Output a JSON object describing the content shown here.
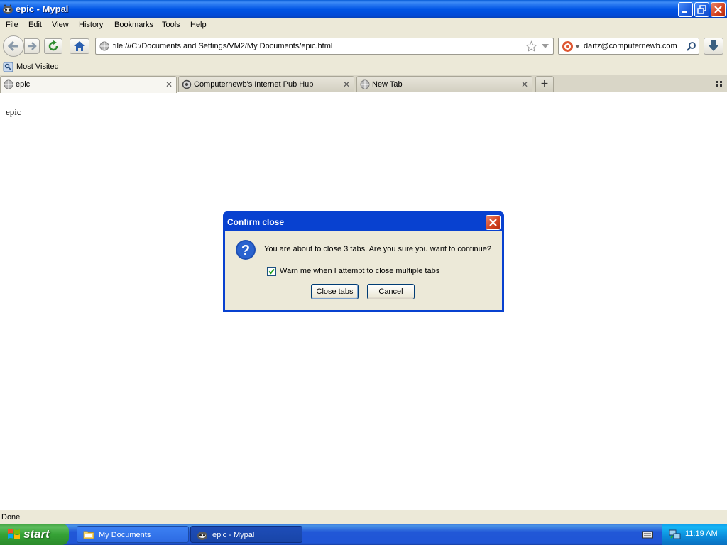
{
  "window": {
    "title": "epic - Mypal",
    "app_icon": "mypal-raccoon-icon"
  },
  "menu": {
    "items": [
      "File",
      "Edit",
      "View",
      "History",
      "Bookmarks",
      "Tools",
      "Help"
    ]
  },
  "navigation": {
    "url": "file:///C:/Documents and Settings/VM2/My Documents/epic.html",
    "search_text": "dartz@computernewb.com",
    "search_engine_icon": "duckduckgo-icon"
  },
  "bookmarks": {
    "most_visited": "Most Visited"
  },
  "tabs": [
    {
      "label": "epic",
      "active": true
    },
    {
      "label": "Computernewb's Internet Pub Hub",
      "active": false
    },
    {
      "label": "New Tab",
      "active": false
    }
  ],
  "content": {
    "text": "epic"
  },
  "dialog": {
    "title": "Confirm close",
    "message": "You are about to close 3 tabs. Are you sure you want to continue?",
    "checkbox_label": "Warn me when I attempt to close multiple tabs",
    "checkbox_checked": true,
    "confirm_label": "Close tabs",
    "cancel_label": "Cancel"
  },
  "status": {
    "text": "Done"
  },
  "taskbar": {
    "start_label": "start",
    "tasks": [
      {
        "label": "My Documents",
        "active": false
      },
      {
        "label": "epic - Mypal",
        "active": true
      }
    ],
    "clock": "11:19 AM"
  },
  "colors": {
    "titlebar_blue": "#0055e5",
    "dialog_blue": "#0841d0",
    "start_green": "#36a336",
    "tray_blue": "#0b8cdb",
    "chrome_beige": "#ece9d8"
  }
}
